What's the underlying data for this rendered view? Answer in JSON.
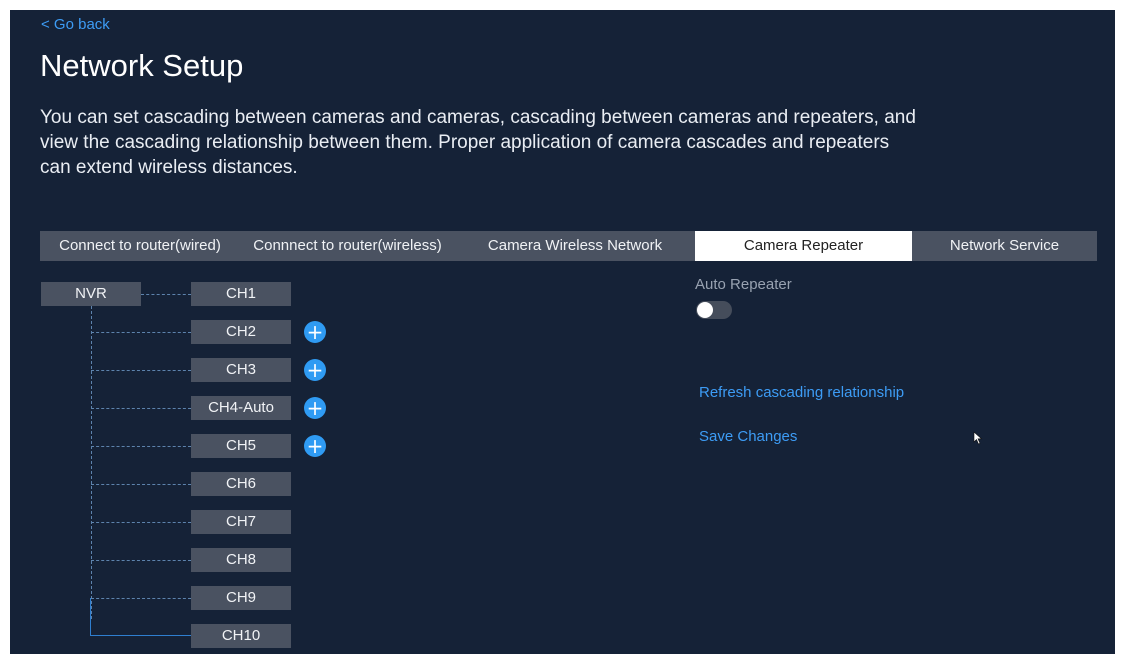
{
  "header": {
    "back_label": "< Go back",
    "title": "Network Setup",
    "description": "You can set cascading between cameras and cameras, cascading between cameras and repeaters, and view the cascading relationship between them. Proper application of camera cascades and repeaters can extend wireless distances."
  },
  "tabs": [
    {
      "label": "Connect to router(wired)",
      "active": false
    },
    {
      "label": "Connnect to router(wireless)",
      "active": false
    },
    {
      "label": "Camera Wireless Network",
      "active": false
    },
    {
      "label": "Camera Repeater",
      "active": true
    },
    {
      "label": "Network Service",
      "active": false
    }
  ],
  "tree": {
    "root": "NVR",
    "channels": [
      "CH1",
      "CH2",
      "CH3",
      "CH4-Auto",
      "CH5",
      "CH6",
      "CH7",
      "CH8",
      "CH9",
      "CH10"
    ],
    "add_buttons_on": [
      "CH2",
      "CH3",
      "CH4-Auto",
      "CH5"
    ]
  },
  "right_panel": {
    "auto_repeater_label": "Auto Repeater",
    "auto_repeater_on": false,
    "refresh_link": "Refresh cascading relationship",
    "save_link": "Save Changes"
  },
  "icons": {
    "add": "plus-circle-icon",
    "cursor": "mouse-pointer-icon"
  },
  "colors": {
    "background": "#152237",
    "accent": "#2f9bf3",
    "link": "#3d9cf5",
    "node": "#4a5261",
    "active_tab": "#ffffff"
  }
}
